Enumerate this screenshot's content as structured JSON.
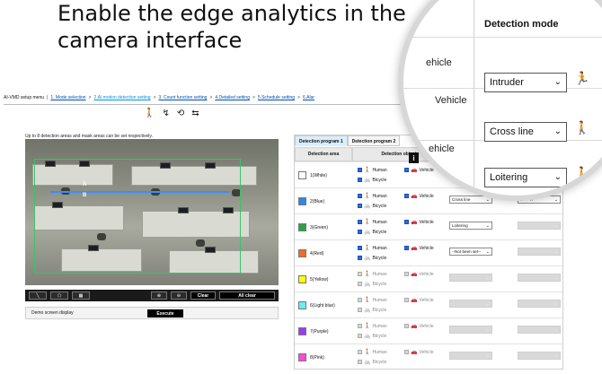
{
  "headline": "Enable the edge analytics in the camera interface",
  "nav": {
    "menu": "AI-VMD setup menu",
    "items": [
      "1. Mode selection",
      "2.AI motion detection setting",
      "3. Count function setting",
      "4.Detailed setting",
      "5.Schedule setting",
      "6.Alar"
    ],
    "active_index": 1
  },
  "note": "Up to 8 detection areas and mask areas can be set respectively.",
  "camera": {
    "label_a": "A",
    "label_b": "B"
  },
  "toolbar": {
    "clear": "Clear",
    "all_clear": "All clear"
  },
  "demo": {
    "label": "Demo screen display",
    "execute": "Execute"
  },
  "tabs": [
    "Detection program 1",
    "Detection program 2"
  ],
  "table": {
    "headers": [
      "Detection area",
      "Detection object"
    ],
    "human": "Human",
    "vehicle": "Vehicle",
    "bicycle": "Bicycle",
    "rows": [
      {
        "area": "1(White)",
        "color": "#ffffff",
        "enabled": true,
        "mode": "Intruder",
        "dir": "",
        "vehicle": true
      },
      {
        "area": "2(Blue)",
        "color": "#2f86e6",
        "enabled": true,
        "mode": "Cross line",
        "dir": "B --> A",
        "vehicle": true
      },
      {
        "area": "3(Green)",
        "color": "#25a544",
        "enabled": true,
        "mode": "Loitering",
        "dir": "",
        "vehicle": true
      },
      {
        "area": "4(Red)",
        "color": "#ee6b2e",
        "enabled": true,
        "mode": "--Not been set--",
        "dir": "",
        "vehicle": true
      },
      {
        "area": "5(Yellow)",
        "color": "#ffff00",
        "enabled": false,
        "mode": "",
        "dir": "",
        "vehicle": false
      },
      {
        "area": "6(Light blue)",
        "color": "#66eef4",
        "enabled": false,
        "mode": "",
        "dir": "",
        "vehicle": false
      },
      {
        "area": "7(Purple)",
        "color": "#9a3df0",
        "enabled": false,
        "mode": "",
        "dir": "",
        "vehicle": false
      },
      {
        "area": "8(Pink)",
        "color": "#ff4ad8",
        "enabled": false,
        "mode": "",
        "dir": "",
        "vehicle": false
      }
    ]
  },
  "magnifier": {
    "header": "Detection mode",
    "rows": [
      {
        "label": "ehicle",
        "mode": "Intruder"
      },
      {
        "label": "Vehicle",
        "mode": "Cross line"
      },
      {
        "label": "ehicle",
        "mode": "Loitering"
      }
    ]
  },
  "colors": {
    "accent": "#0a8fd8",
    "panel_tab_active": "#d9eefb",
    "cam_box": "#3cc26a",
    "cam_line": "#3b8cff"
  }
}
